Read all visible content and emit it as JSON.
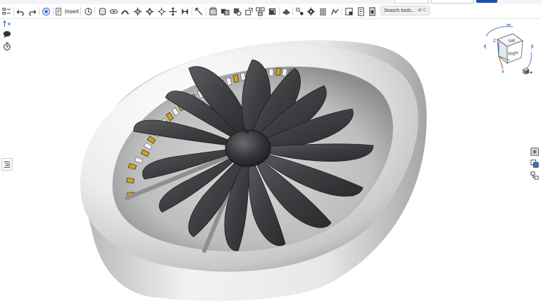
{
  "toolbar": {
    "insert_label": "Insert",
    "search_placeholder": "Search tools...",
    "search_shortcut": "alt C"
  },
  "viewcube": {
    "face_top": "Top",
    "face_right": "Right",
    "axis_z": "Z",
    "axis_x": "X"
  },
  "icons": [
    "undo-icon",
    "redo-icon",
    "feature-icon",
    "insert-icon",
    "sketch-icon",
    "extrude-icon",
    "revolve-icon",
    "sweep-icon",
    "loft-icon",
    "thicken-icon",
    "fillet-icon",
    "chamfer-icon",
    "shell-icon",
    "draft-icon",
    "rib-icon",
    "boolean-icon",
    "split-icon",
    "transform-icon",
    "pattern-icon",
    "mirror-icon",
    "plane-icon",
    "mate-icon",
    "measure-icon",
    "render-icon",
    "more-icon"
  ],
  "colors": {
    "toolbar_bg": "#ffffff",
    "accent_blue": "#1f4bbf",
    "duct": "#e6e6e6",
    "blade": "#3f4043",
    "stator": "#d8a010"
  }
}
